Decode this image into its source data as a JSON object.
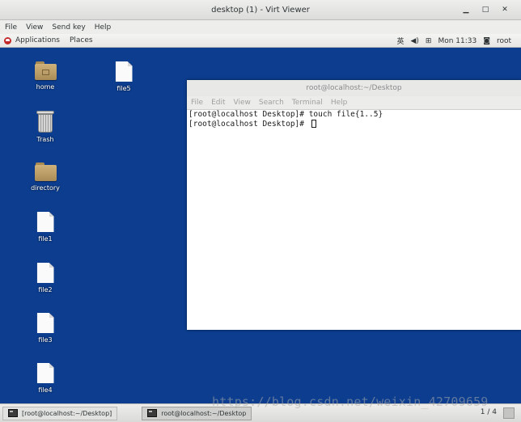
{
  "window": {
    "title": "desktop (1) - Virt Viewer",
    "controls": [
      "▁",
      "□",
      "✕"
    ]
  },
  "menubar": [
    "File",
    "View",
    "Send key",
    "Help"
  ],
  "panel": {
    "applications": "Applications",
    "places": "Places",
    "ime": "英",
    "clock": "Mon 11:33",
    "user": "root"
  },
  "desktop_icons": [
    {
      "label": "home",
      "type": "folder-home"
    },
    {
      "label": "file5",
      "type": "file"
    },
    {
      "label": "Trash",
      "type": "trash"
    },
    {
      "label": "directory",
      "type": "folder"
    },
    {
      "label": "file1",
      "type": "file"
    },
    {
      "label": "file2",
      "type": "file"
    },
    {
      "label": "file3",
      "type": "file"
    },
    {
      "label": "file4",
      "type": "file"
    }
  ],
  "terminal": {
    "title": "root@localhost:~/Desktop",
    "menu": [
      "File",
      "Edit",
      "View",
      "Search",
      "Terminal",
      "Help"
    ],
    "lines": [
      "[root@localhost Desktop]# touch file{1..5}",
      "[root@localhost Desktop]# "
    ]
  },
  "taskbar": {
    "tasks": [
      "[root@localhost:~/Desktop]",
      "root@localhost:~/Desktop"
    ],
    "pager": "1 / 4"
  },
  "watermark": "https://blog.csdn.net/weixin_42709659"
}
